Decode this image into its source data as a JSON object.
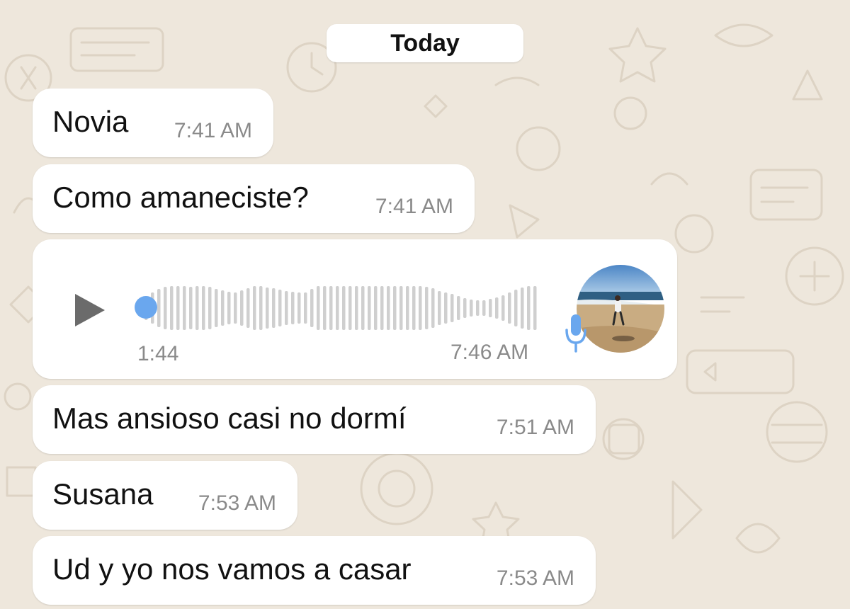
{
  "date_separator": "Today",
  "messages": [
    {
      "text": "Novia",
      "time": "7:41 AM"
    },
    {
      "text": "Como amaneciste?",
      "time": "7:41 AM"
    },
    {
      "text": "Mas ansioso casi no dormí",
      "time": "7:51 AM"
    },
    {
      "text": "Susana",
      "time": "7:53 AM"
    },
    {
      "text": "Ud y yo nos vamos a casar",
      "time": "7:53 AM"
    }
  ],
  "voice_message": {
    "duration": "1:44",
    "time": "7:46 AM",
    "progress": 0,
    "icons": [
      "play-icon",
      "microphone-icon"
    ],
    "colors": {
      "accent": "#6aa7ee",
      "waveform": "#cfcfcf"
    }
  },
  "colors": {
    "background": "#eee7dc",
    "bubble": "#ffffff",
    "timestamp": "#8a8a8a"
  }
}
